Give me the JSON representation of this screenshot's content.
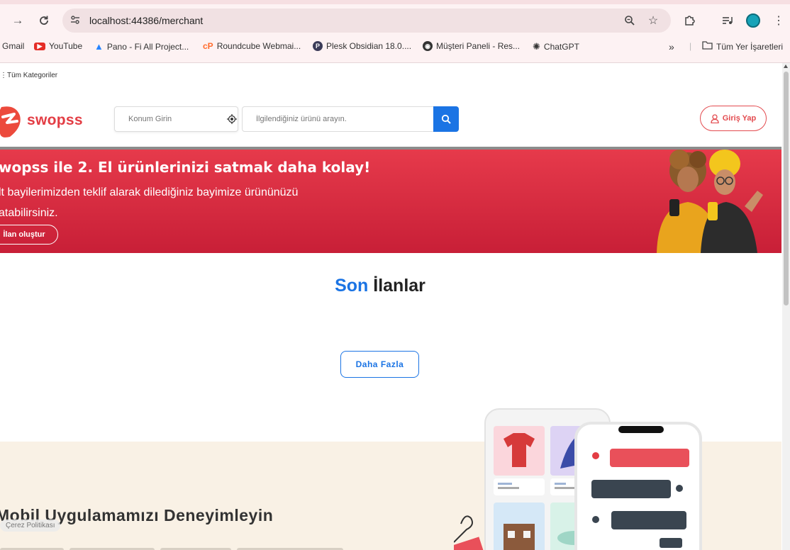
{
  "browser": {
    "url": "localhost:44386/merchant",
    "bookmarks": [
      {
        "label": "Gmail",
        "icon": "gmail-icon"
      },
      {
        "label": "YouTube",
        "icon": "youtube-icon"
      },
      {
        "label": "Pano - Fi All Project...",
        "icon": "jira-icon"
      },
      {
        "label": "Roundcube Webmai...",
        "icon": "cpanel-icon"
      },
      {
        "label": "Plesk Obsidian 18.0....",
        "icon": "plesk-icon"
      },
      {
        "label": "Müşteri Paneli - Res...",
        "icon": "globe-icon"
      },
      {
        "label": "ChatGPT",
        "icon": "chatgpt-icon"
      }
    ],
    "all_bookmarks_label": "Tüm Yer İşaretleri",
    "overflow_label": "»"
  },
  "site": {
    "all_categories": "Tüm Kategoriler",
    "logo_text": "swopss",
    "location_placeholder": "Konum Girin",
    "search_placeholder": "İlgilendiğiniz ürünü arayın.",
    "login_label": "Giriş Yap",
    "colors": {
      "brand_red": "#e33d44",
      "accent_blue": "#1b74e4"
    }
  },
  "banner": {
    "title": "wopss ile 2. El ürünlerinizi satmak daha kolay!",
    "subtitle": "lt bayilerimizden teklif alarak dilediğiniz bayimize ürününüzü atabilirsiniz.",
    "button": "İlan oluştur"
  },
  "latest": {
    "title_accent": "Son",
    "title_rest": " İlanlar",
    "more_button": "Daha Fazla"
  },
  "app_promo": {
    "title": "Mobil Uygulamamızı Deneyimleyin",
    "cookie_label": "Çerez Politikası"
  }
}
